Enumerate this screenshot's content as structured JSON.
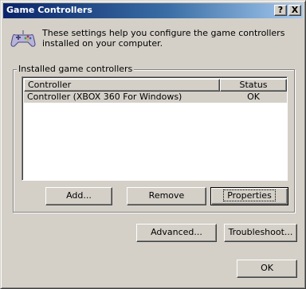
{
  "window": {
    "title": "Game Controllers",
    "help_label": "?",
    "close_label": "X"
  },
  "intro": {
    "icon": "gamepad-icon",
    "text": "These settings help you configure the game controllers installed on your computer."
  },
  "group": {
    "label": "Installed game controllers"
  },
  "list": {
    "columns": [
      "Controller",
      "Status"
    ],
    "rows": [
      {
        "controller": "Controller (XBOX 360 For Windows)",
        "status": "OK",
        "selected": true
      }
    ]
  },
  "buttons": {
    "add": "Add...",
    "remove": "Remove",
    "properties": "Properties",
    "advanced": "Advanced...",
    "troubleshoot": "Troubleshoot...",
    "ok": "OK"
  }
}
